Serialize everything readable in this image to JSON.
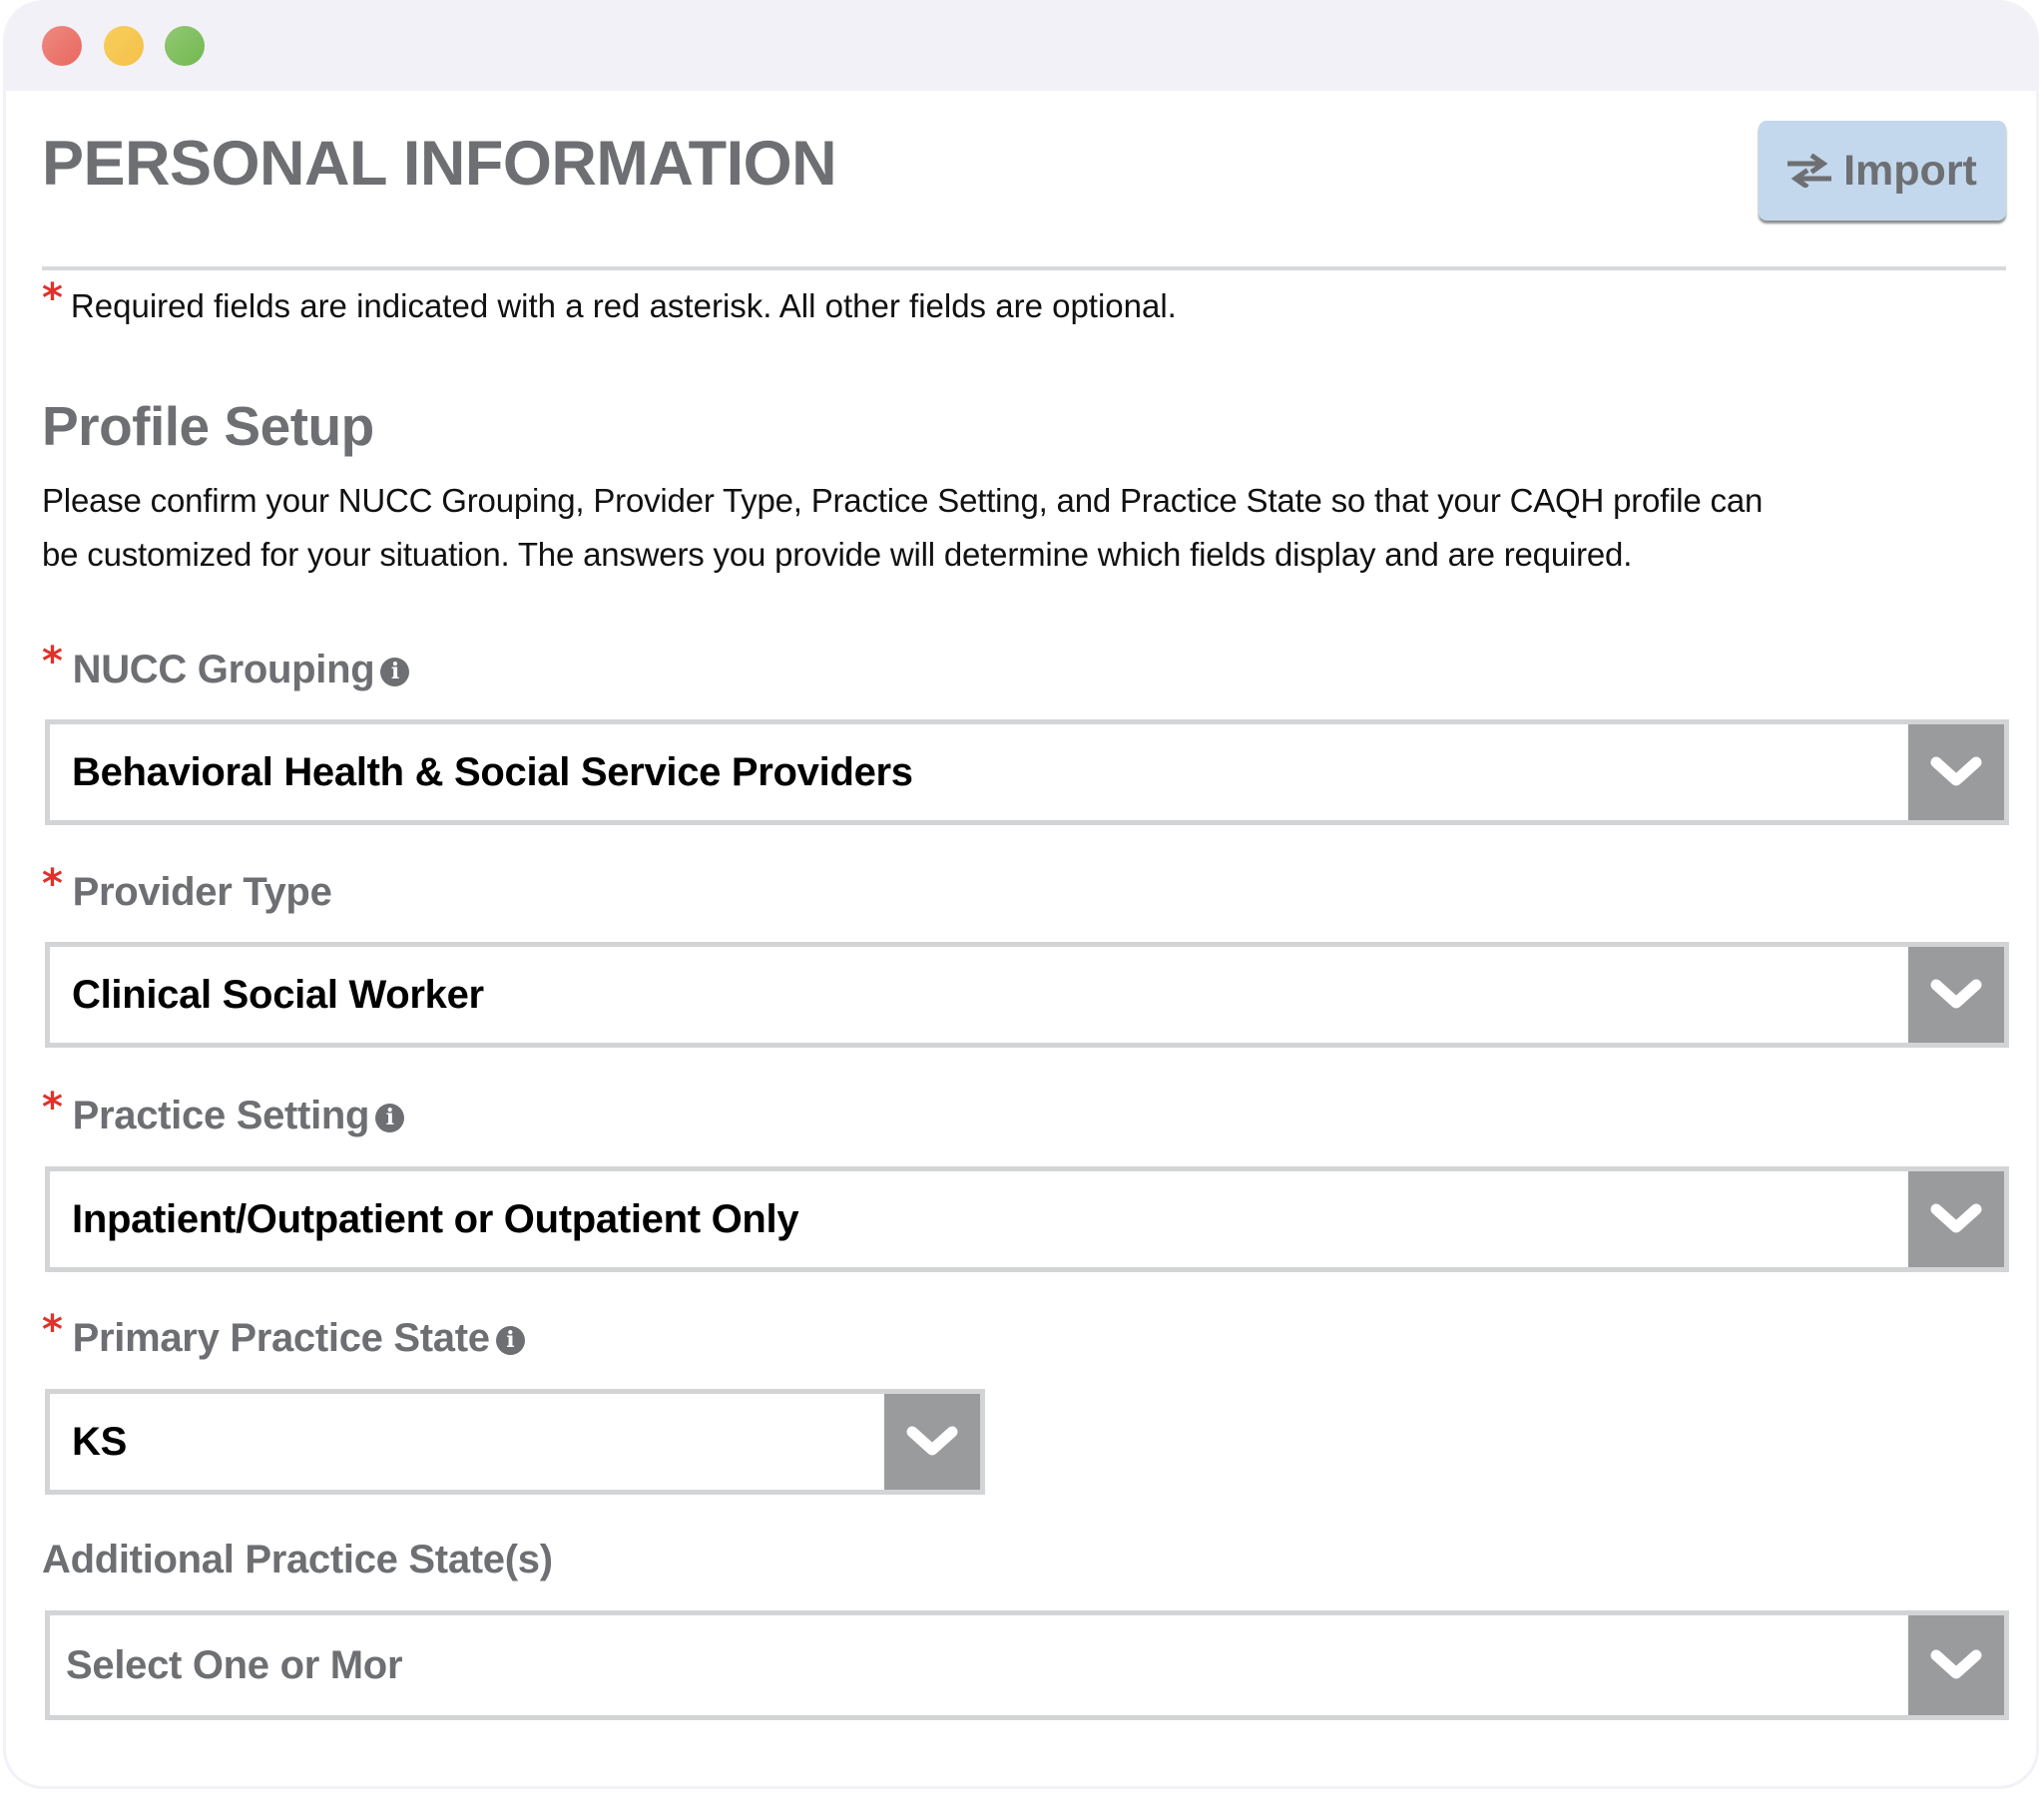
{
  "window": {
    "controls": [
      "close",
      "minimize",
      "maximize"
    ]
  },
  "header": {
    "title": "PERSONAL INFORMATION",
    "import_button": {
      "label": "Import",
      "icon": "exchange-arrows-icon"
    }
  },
  "required_note": {
    "marker": "*",
    "text": "Required fields are indicated with a red asterisk. All other fields are optional."
  },
  "profile_setup": {
    "title": "Profile Setup",
    "description_lines": [
      "Please confirm your NUCC Grouping, Provider Type, Practice Setting, and Practice State so that your CAQH profile can",
      "be customized for your situation. The answers you provide will determine which fields display and are required."
    ]
  },
  "fields": [
    {
      "label": "NUCC Grouping",
      "required": true,
      "info": true,
      "value": "Behavioral Health & Social Service Providers"
    },
    {
      "label": "Provider Type",
      "required": true,
      "info": false,
      "value": "Clinical Social Worker"
    },
    {
      "label": "Practice Setting",
      "required": true,
      "info": true,
      "value": "Inpatient/Outpatient or Outpatient Only"
    },
    {
      "label": "Primary Practice State",
      "required": true,
      "info": true,
      "value": "KS"
    },
    {
      "label": "Additional Practice State(s)",
      "required": false,
      "info": false,
      "value": "",
      "placeholder": "Select One or Mor"
    }
  ],
  "colors": {
    "required_asterisk": "#e0322b",
    "label_gray": "#6d6f72",
    "import_button_bg": "#c3d8ec",
    "dropdown_button_bg": "#9a9b9d",
    "field_border": "#d3d4d6",
    "titlebar_bg": "#f3f1f8"
  },
  "required_marker": "*",
  "info_glyph": "i"
}
